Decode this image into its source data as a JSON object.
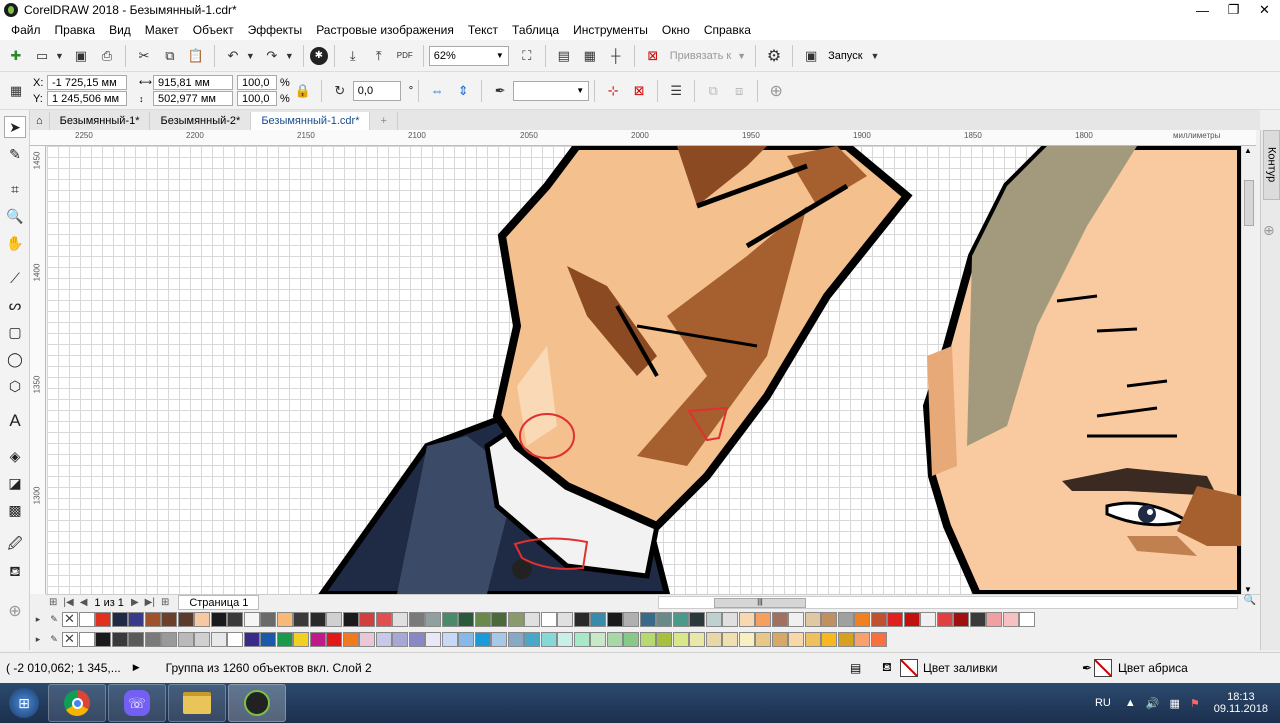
{
  "app": {
    "title": "CorelDRAW 2018 - Безымянный-1.cdr*"
  },
  "window_controls": {
    "minimize": "—",
    "restore": "❐",
    "close": "✕"
  },
  "menu": [
    "Файл",
    "Правка",
    "Вид",
    "Макет",
    "Объект",
    "Эффекты",
    "Растровые изображения",
    "Текст",
    "Таблица",
    "Инструменты",
    "Окно",
    "Справка"
  ],
  "toolbar": {
    "zoom_value": "62%",
    "snap_label": "Привязать к",
    "launch_label": "Запуск"
  },
  "property_bar": {
    "x_label": "X:",
    "x_value": "-1 725,15 мм",
    "y_label": "Y:",
    "y_value": "1 245,506 мм",
    "width_value": "915,81 мм",
    "height_value": "502,977 мм",
    "scale_x": "100,0",
    "scale_y": "100,0",
    "percent": "%",
    "rotation": "0,0",
    "degree": "°"
  },
  "doc_tabs": [
    {
      "label": "Безымянный-1*",
      "active": false
    },
    {
      "label": "Безымянный-2*",
      "active": false
    },
    {
      "label": "Безымянный-1.cdr*",
      "active": true
    }
  ],
  "ruler": {
    "h_ticks": [
      "2250",
      "2200",
      "2150",
      "2100",
      "2050",
      "2000",
      "1950",
      "1900",
      "1850",
      "1800"
    ],
    "units": "миллиметры",
    "v_ticks": [
      "1450",
      "1400",
      "1350",
      "1300"
    ]
  },
  "right_dock": {
    "tab_label": "Контур"
  },
  "page_nav": {
    "page_counter": "1 из 1",
    "page_tab": "Страница 1"
  },
  "palette_row1": [
    "#ffffff",
    "#e0301e",
    "#1f2a44",
    "#3a3a8c",
    "#a0522d",
    "#6b3f2a",
    "#5a3a2a",
    "#f6c9a0",
    "#1a1a1a",
    "#3a3a3a",
    "#f5f5f5",
    "#6a6a6a",
    "#f8b878",
    "#3a3a3a",
    "#2a2a2a",
    "#d0d0d0",
    "#1a1a1a",
    "#d04040",
    "#e05050",
    "#e0e0e0",
    "#7a7a7a",
    "#90a0a0",
    "#4a8a6a",
    "#2a5a3a",
    "#6a8a4a",
    "#4a6a3a",
    "#8a9a6a",
    "#e0e0e0",
    "#ffffff",
    "#e0e0e0",
    "#2a2a2a",
    "#3a8aaa",
    "#1a1a1a",
    "#b0b0b0",
    "#3a6a8a",
    "#6a8a8a",
    "#4a9a8a",
    "#2a3a3a",
    "#c0d0d0",
    "#e0e0e0",
    "#f8d8b0",
    "#f6a060",
    "#a07060",
    "#f0f0f0",
    "#e0c8a0",
    "#c09060",
    "#a0a0a0",
    "#f08020",
    "#c05030",
    "#e02020",
    "#c01010",
    "#f0f0f0",
    "#e04040",
    "#a01010",
    "#3a3a3a",
    "#f0a0a0",
    "#f8c0c0",
    "#ffffff"
  ],
  "palette_row2": [
    "#ffffff",
    "#1a1a1a",
    "#3a3a3a",
    "#5a5a5a",
    "#7a7a7a",
    "#9a9a9a",
    "#bababa",
    "#d0d0d0",
    "#e8e8e8",
    "#ffffff",
    "#3a2a8a",
    "#1a5aa8",
    "#1a9a4a",
    "#f0d020",
    "#c01a8a",
    "#e01a1a",
    "#f07a20",
    "#e8c8d8",
    "#c8c8e8",
    "#a8a8d8",
    "#8888c8",
    "#e8e8f8",
    "#c8d8f8",
    "#88b8e8",
    "#1a9ad8",
    "#a8c8e8",
    "#88a8c8",
    "#48a8c8",
    "#88d8d8",
    "#c8f0e8",
    "#a8e8c8",
    "#c8e8c8",
    "#a8d8a8",
    "#88c888",
    "#b8d870",
    "#a8c040",
    "#d8e888",
    "#e8e8a8",
    "#e8d8a8",
    "#f0e0b0",
    "#f8f0c0",
    "#e8c888",
    "#d8a868",
    "#f8d8a8",
    "#f0c060",
    "#f8b820",
    "#d8a020",
    "#f8a070",
    "#f87040"
  ],
  "status": {
    "coords": "( -2 010,062; 1 345,...",
    "object_info": "Группа из 1260 объектов вкл. Слой 2",
    "fill_label": "Цвет заливки",
    "outline_label": "Цвет абриса"
  },
  "taskbar": {
    "lang": "RU",
    "time": "18:13",
    "date": "09.11.2018"
  },
  "icons": {
    "new": "✚",
    "open": "📂",
    "save": "💾",
    "print": "🖨",
    "undo": "↶",
    "redo": "↷",
    "gear": "⚙"
  }
}
